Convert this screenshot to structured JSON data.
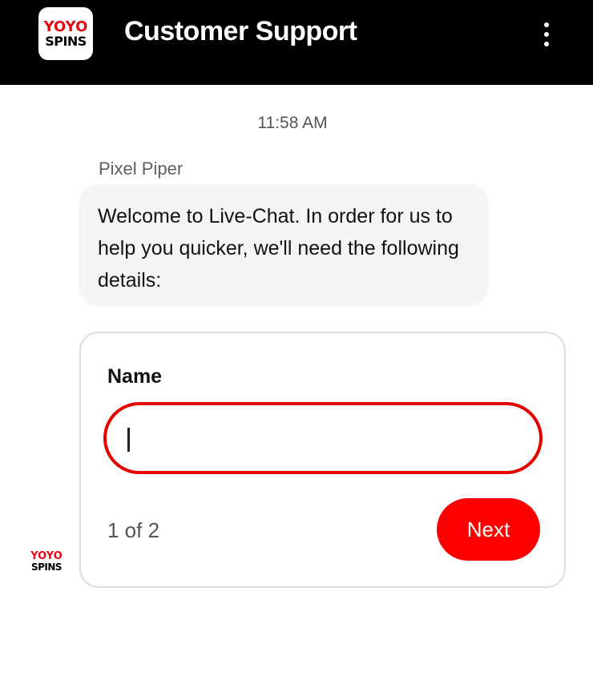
{
  "header": {
    "logo_top": "YOYO",
    "logo_bottom": "SPINS",
    "title": "Customer Support",
    "menu_icon": "more-vertical-icon"
  },
  "colors": {
    "brand_red": "#e30613",
    "header_bg": "#000000",
    "button_red": "#ff0000",
    "input_border": "#e50000",
    "bubble_bg": "#f4f5f6"
  },
  "chat": {
    "timestamp": "11:58 AM",
    "agent_name": "Pixel Piper",
    "message": "Welcome to Live-Chat. In order for us to help you quicker, we'll need the following details:"
  },
  "form": {
    "field_label": "Name",
    "field_value": "",
    "field_placeholder": "",
    "pager": "1 of 2",
    "next_label": "Next"
  },
  "avatar": {
    "logo_top": "YOYO",
    "logo_bottom": "SPINS"
  }
}
